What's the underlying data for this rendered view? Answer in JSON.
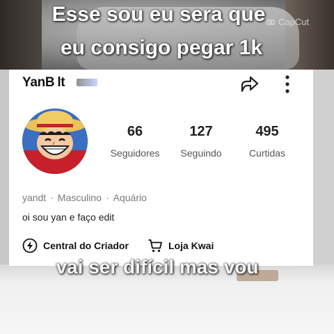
{
  "overlay": {
    "caption_line1": "Esse sou eu sera que",
    "caption_line2": "eu consigo pegar 1k",
    "caption_bottom": "vai ser difícil mas vou",
    "watermark": "CapCut"
  },
  "profile": {
    "username": "YanB",
    "username_rest": "lt",
    "avatar_icon": "luffy-avatar",
    "stats": [
      {
        "value": "66",
        "label": "Seguidores"
      },
      {
        "value": "127",
        "label": "Seguindo"
      },
      {
        "value": "495",
        "label": "Curtidas"
      }
    ],
    "handle": "yandt",
    "gender": "Masculino",
    "sign": "Aquário",
    "separator": "·",
    "bio": "oi sou yan e faço edit",
    "actions": {
      "creator_center": "Central do Criador",
      "shop": "Loja Kwai"
    }
  },
  "icons": {
    "share": "share-icon",
    "more": "more-vertical-icon",
    "creator": "lightning-icon",
    "shop": "cart-icon"
  }
}
